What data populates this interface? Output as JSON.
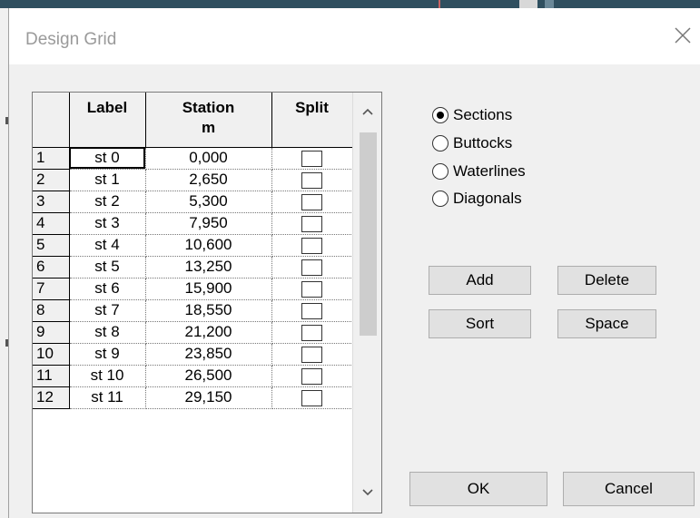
{
  "dialog": {
    "title": "Design Grid"
  },
  "grid": {
    "headers": {
      "label": "Label",
      "station": "Station",
      "station_unit": "m",
      "split": "Split"
    },
    "rows": [
      {
        "num": "1",
        "label": "st 0",
        "station": "0,000",
        "split": false
      },
      {
        "num": "2",
        "label": "st 1",
        "station": "2,650",
        "split": false
      },
      {
        "num": "3",
        "label": "st 2",
        "station": "5,300",
        "split": false
      },
      {
        "num": "4",
        "label": "st 3",
        "station": "7,950",
        "split": false
      },
      {
        "num": "5",
        "label": "st 4",
        "station": "10,600",
        "split": false
      },
      {
        "num": "6",
        "label": "st 5",
        "station": "13,250",
        "split": false
      },
      {
        "num": "7",
        "label": "st 6",
        "station": "15,900",
        "split": false
      },
      {
        "num": "8",
        "label": "st 7",
        "station": "18,550",
        "split": false
      },
      {
        "num": "9",
        "label": "st 8",
        "station": "21,200",
        "split": false
      },
      {
        "num": "10",
        "label": "st 9",
        "station": "23,850",
        "split": false
      },
      {
        "num": "11",
        "label": "st 10",
        "station": "26,500",
        "split": false
      },
      {
        "num": "12",
        "label": "st 11",
        "station": "29,150",
        "split": false
      }
    ]
  },
  "grid_type": {
    "options": [
      "Sections",
      "Buttocks",
      "Waterlines",
      "Diagonals"
    ],
    "selected": "Sections"
  },
  "buttons": {
    "add": "Add",
    "delete": "Delete",
    "sort": "Sort",
    "space": "Space",
    "ok": "OK",
    "cancel": "Cancel"
  },
  "colors": {
    "dialog_bg": "#f0f0f0",
    "button_bg": "#e1e1e1",
    "background_window_bar": "#2f4f5f"
  }
}
